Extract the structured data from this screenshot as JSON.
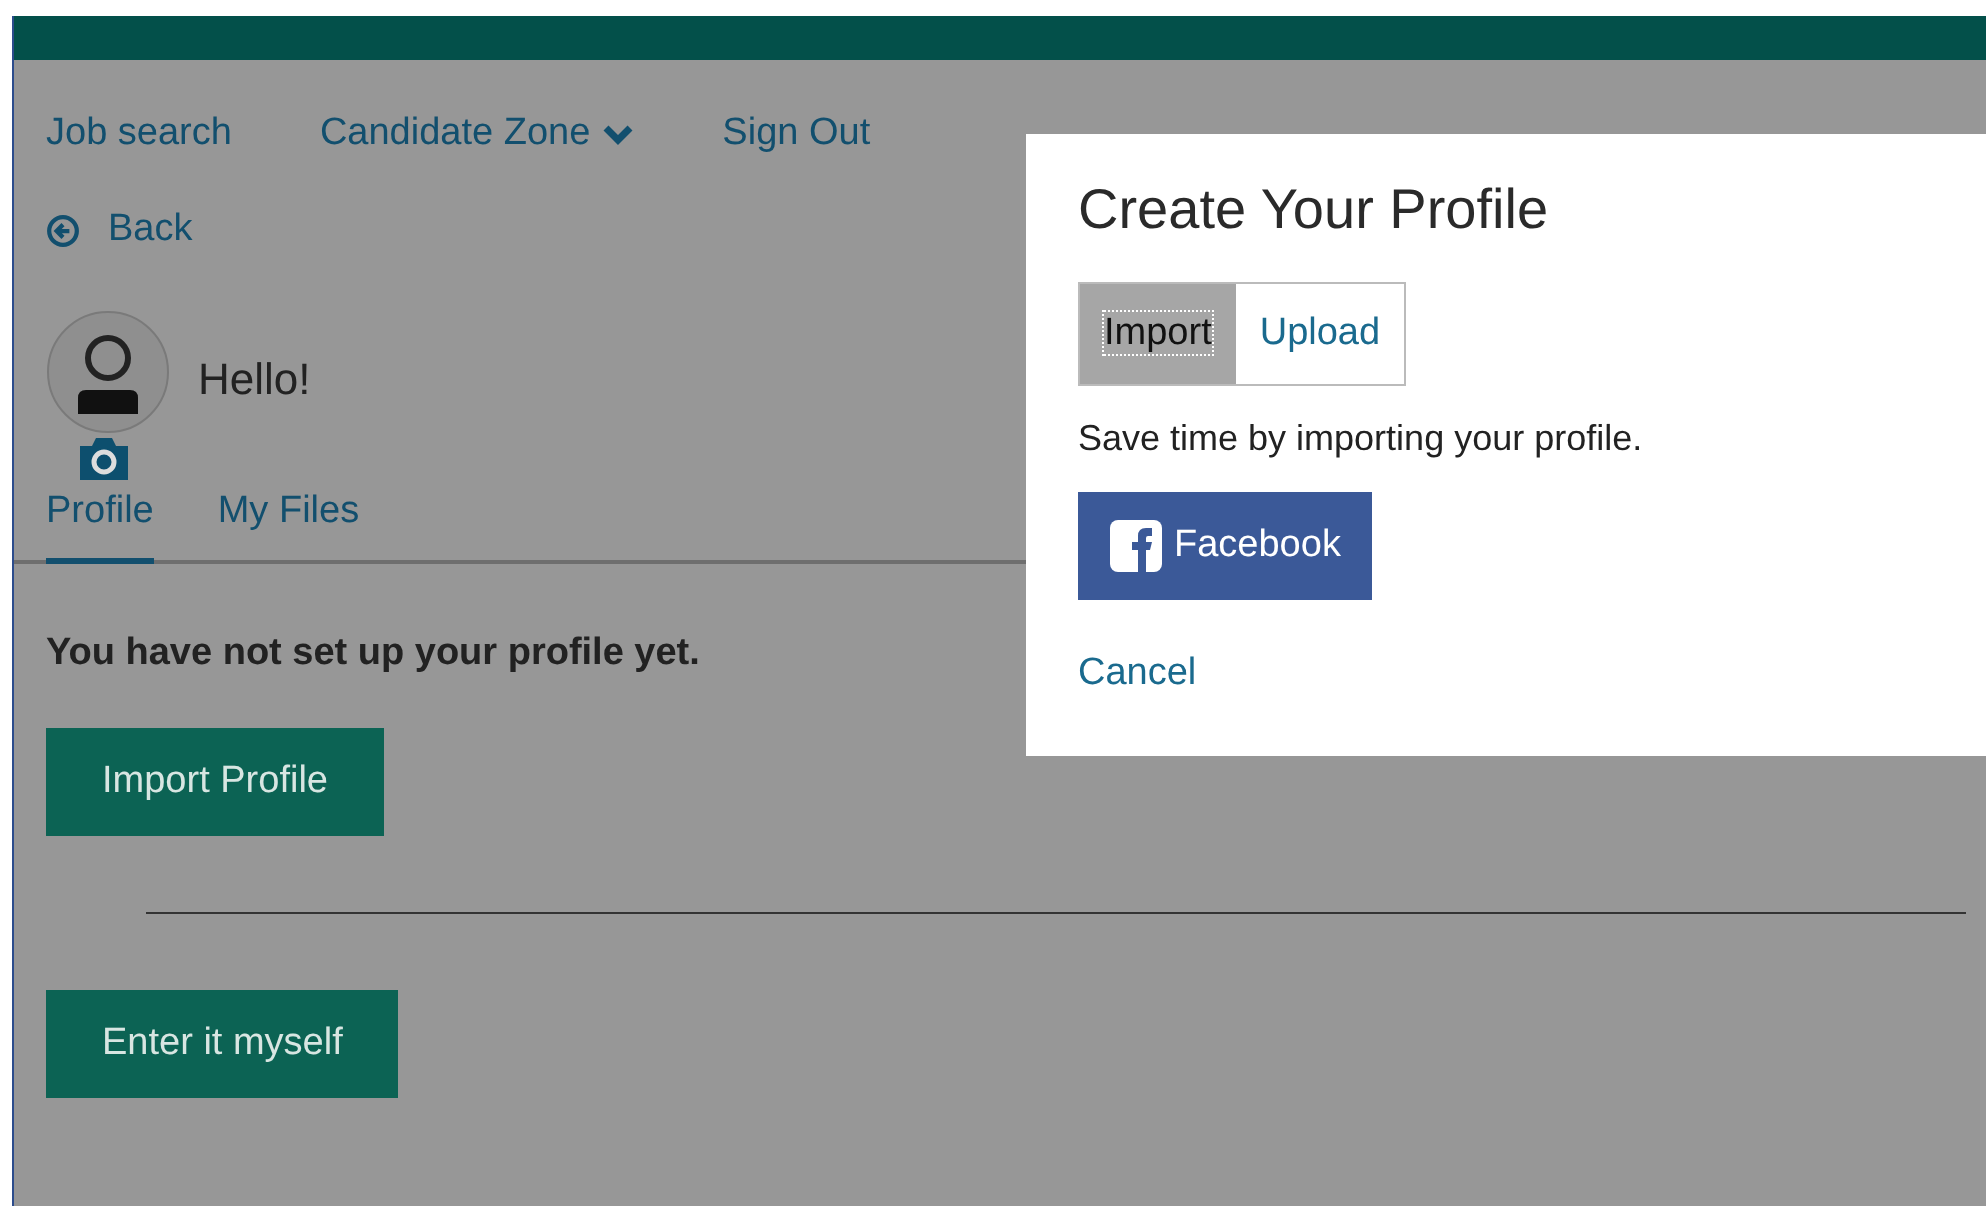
{
  "nav": {
    "items": [
      {
        "label": "Job search",
        "kind": "link"
      },
      {
        "label": "Candidate Zone",
        "kind": "dropdown"
      },
      {
        "label": "Sign Out",
        "kind": "link"
      }
    ]
  },
  "back": {
    "label": "Back"
  },
  "greeting": "Hello!",
  "tabs": [
    {
      "label": "Profile",
      "selected": true
    },
    {
      "label": "My Files",
      "selected": false
    }
  ],
  "message": "You have not set up your profile yet.",
  "import_button": "Import Profile",
  "manual_button": "Enter it myself",
  "dialog": {
    "title": "Create Your Profile",
    "tabs": [
      {
        "label": "Import",
        "selected": true
      },
      {
        "label": "Upload",
        "selected": false
      }
    ],
    "description": "Save time by importing your profile.",
    "facebook_button": "Facebook",
    "cancel": "Cancel"
  }
}
